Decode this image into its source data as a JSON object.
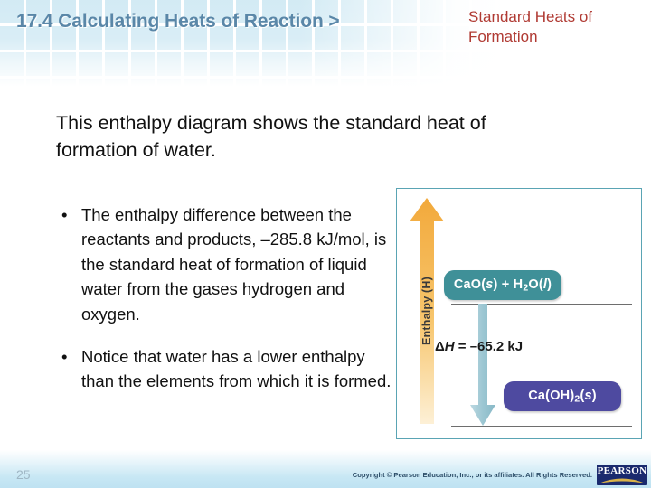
{
  "slide": {
    "title": "17.4 Calculating Heats of Reaction >",
    "subtitle": "Standard Heats of Formation",
    "lead_text": "This enthalpy diagram shows the standard heat of formation of water.",
    "bullet_marker": "•",
    "bullets": [
      "The enthalpy difference between the reactants and products, –285.8 kJ/mol, is the standard heat of formation of liquid water from the gases hydrogen and oxygen.",
      "Notice that water has a lower enthalpy than the elements from which it is formed."
    ]
  },
  "diagram": {
    "axis_label": "Enthalpy (H)",
    "reactants_label_html": "CaO(<i>s</i>) + H<sub>2</sub>O(<i>l</i>)",
    "reactants_label_text": "CaO(s) + H2O(l)",
    "products_label_html": "Ca(OH)<sub>2</sub>(<i>s</i>)",
    "products_label_text": "Ca(OH)2(s)",
    "delta_h_html": "Δ<i>H</i> = –65.2 kJ",
    "delta_h_text": "ΔH = -65.2 kJ",
    "delta_h_value": -65.2,
    "delta_h_units": "kJ",
    "colors": {
      "frame_border": "#5aa4b4",
      "enthalpy_arrow": "#f2a93b",
      "reactants_chip": "#3f9098",
      "products_chip": "#4e4aa0",
      "delta_arrow": "#9cc6d2",
      "level_line": "#6e6e6e"
    }
  },
  "footer": {
    "page_number": "25",
    "copyright": "Copyright © Pearson Education, Inc., or its affiliates. All Rights Reserved.",
    "logo_text": "PEARSON"
  },
  "theme": {
    "title_color": "#5a87a8",
    "subtitle_color": "#b03a33",
    "tile_color": "#c9e6f2",
    "footer_gradient_end": "#bfe2f2"
  }
}
